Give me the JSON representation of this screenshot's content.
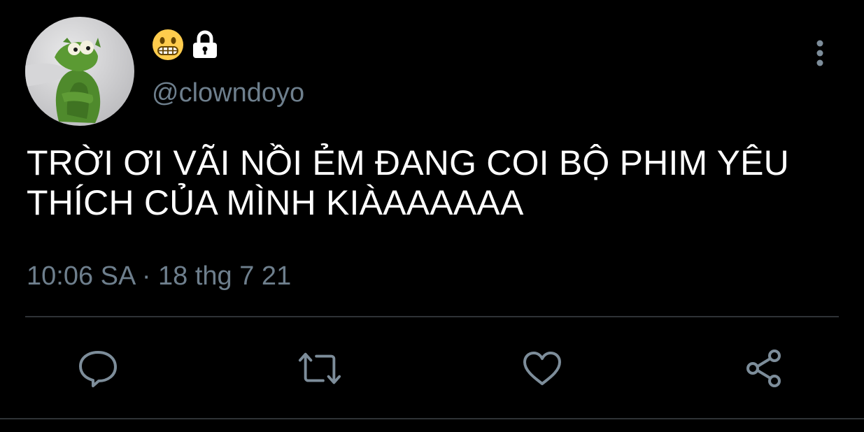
{
  "user": {
    "emoji_icon": "grimacing-face-emoji",
    "lock_icon": "lock-icon",
    "handle": "@clowndoyo",
    "avatar_icon": "kermit-frog-avatar"
  },
  "tweet": {
    "text": "TRỜI ƠI VÃI NỒI ẺM ĐANG COI BỘ PHIM YÊU THÍCH CỦA MÌNH KIÀAAAAAA",
    "time": "10:06 SA",
    "separator": "·",
    "date": "18 thg 7 21"
  },
  "actions": [
    {
      "icon": "reply-icon"
    },
    {
      "icon": "retweet-icon"
    },
    {
      "icon": "like-icon"
    },
    {
      "icon": "share-icon"
    }
  ],
  "colors": {
    "background": "#000000",
    "text": "#ffffff",
    "secondary_text": "#6e7f8d",
    "icon": "#7d8d9a",
    "divider": "#2f3336"
  }
}
